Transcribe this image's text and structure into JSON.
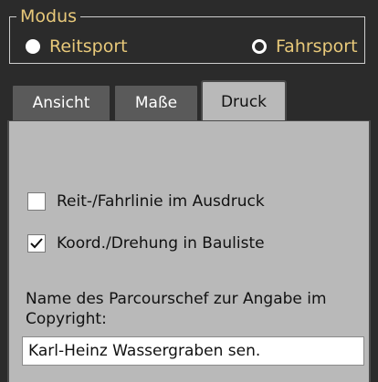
{
  "modus": {
    "title": "Modus",
    "options": [
      {
        "label": "Reitsport",
        "selected": true
      },
      {
        "label": "Fahrsport",
        "selected": false
      }
    ]
  },
  "tabs": [
    {
      "label": "Ansicht",
      "active": false
    },
    {
      "label": "Maße",
      "active": false
    },
    {
      "label": "Druck",
      "active": true
    }
  ],
  "druck": {
    "checkboxes": [
      {
        "label": "Reit-/Fahrlinie im Ausdruck",
        "checked": false
      },
      {
        "label": "Koord./Drehung in Bauliste",
        "checked": true
      }
    ],
    "copyright_label": "Name des Parcourschef zur Angabe im Copyright:",
    "copyright_value": "Karl-Heinz Wassergraben sen."
  },
  "colors": {
    "background": "#2b2b2b",
    "accent_text": "#e8c97a",
    "panel": "#b9b9b9",
    "tab_inactive": "#5a5a5a"
  }
}
